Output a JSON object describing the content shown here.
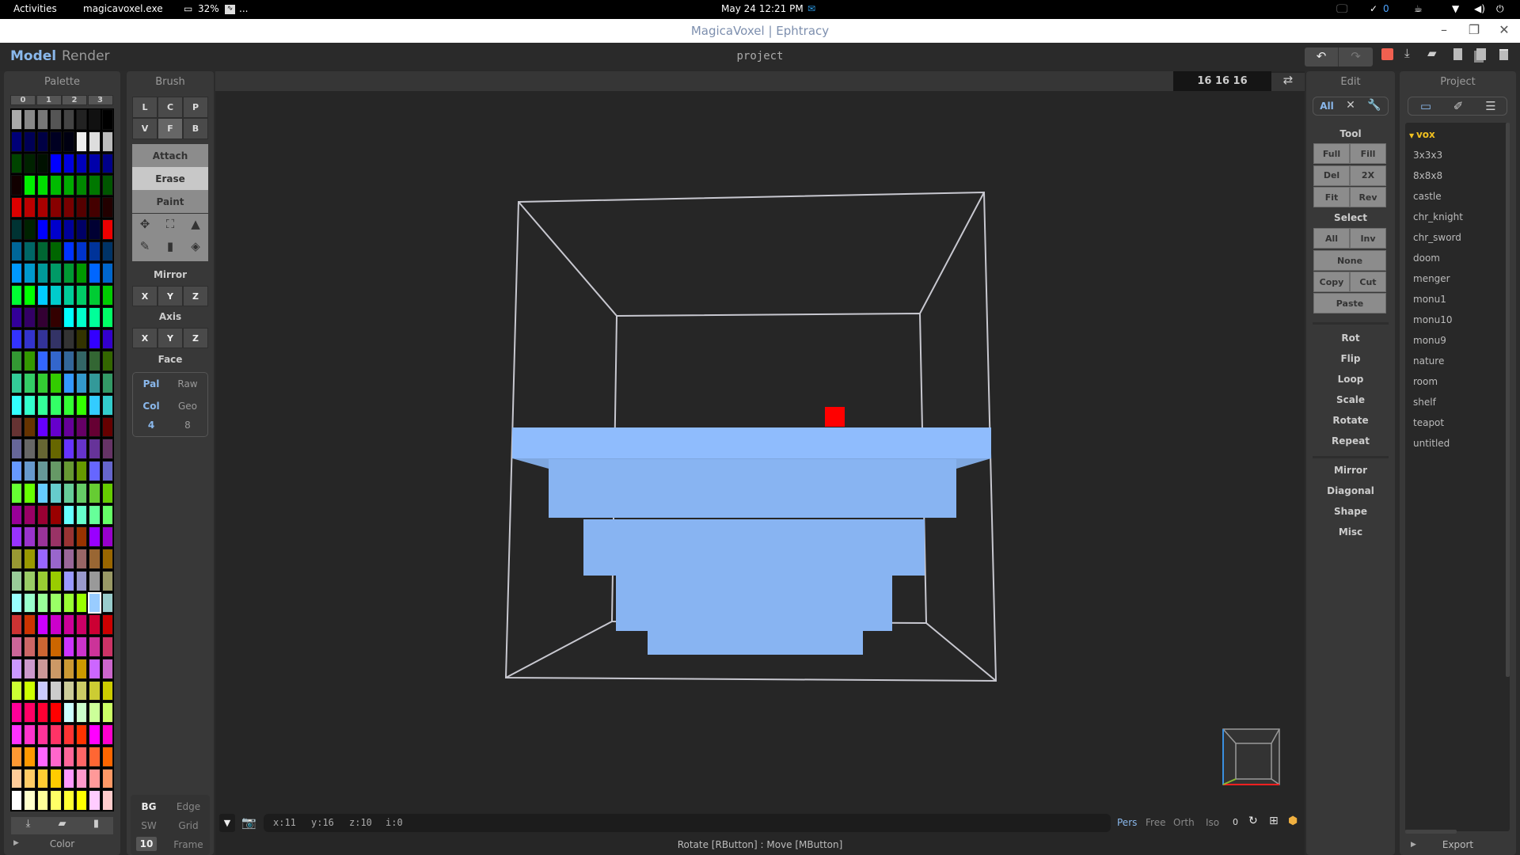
{
  "system_bar": {
    "activities": "Activities",
    "app_name": "magicavoxel.exe",
    "cpu": "32%",
    "ellipsis": "...",
    "datetime": "May 24  12:21 PM",
    "notifications": "0"
  },
  "window": {
    "title": "MagicaVoxel | Ephtracy"
  },
  "header": {
    "tabs": [
      {
        "label": "Model",
        "active": true
      },
      {
        "label": "Render",
        "active": false
      }
    ],
    "project_name": "project"
  },
  "palette": {
    "title": "Palette",
    "pages": [
      "0",
      "1",
      "2",
      "3"
    ],
    "footer_label": "Color",
    "selected_color": "#99ccff",
    "rows": [
      [
        "#aaaaaa",
        "#888888",
        "#777777",
        "#555555",
        "#444444",
        "#222222",
        "#111111",
        "#000000"
      ],
      [
        "#000077",
        "#000055",
        "#000044",
        "#000022",
        "#000011",
        "#eeeeee",
        "#dddddd",
        "#bbbbbb"
      ],
      [
        "#004400",
        "#002200",
        "#001100",
        "#0000ff",
        "#0000dd",
        "#0000bb",
        "#0000aa",
        "#000088"
      ],
      [
        "#110000",
        "#00ee00",
        "#00dd00",
        "#00bb00",
        "#00aa00",
        "#008800",
        "#007700",
        "#005500"
      ],
      [
        "#dd0000",
        "#bb0000",
        "#aa0000",
        "#880000",
        "#770000",
        "#550000",
        "#440000",
        "#220000"
      ],
      [
        "#003333",
        "#002200",
        "#0000ff",
        "#0000cc",
        "#000099",
        "#000066",
        "#000033",
        "#ee0000"
      ],
      [
        "#006699",
        "#006666",
        "#006633",
        "#006600",
        "#0033ff",
        "#0033cc",
        "#003399",
        "#003366"
      ],
      [
        "#0099ff",
        "#0099cc",
        "#009999",
        "#009966",
        "#009933",
        "#009900",
        "#0066ff",
        "#0066cc"
      ],
      [
        "#00ff33",
        "#00ff00",
        "#00ccff",
        "#00cccc",
        "#00cc99",
        "#00cc66",
        "#00cc33",
        "#00cc00"
      ],
      [
        "#330099",
        "#330066",
        "#330033",
        "#330000",
        "#00ffff",
        "#00ffcc",
        "#00ff99",
        "#00ff66"
      ],
      [
        "#3333ff",
        "#3333cc",
        "#333399",
        "#333366",
        "#333333",
        "#333300",
        "#3300ff",
        "#3300cc"
      ],
      [
        "#339933",
        "#339900",
        "#3366ff",
        "#3366cc",
        "#336699",
        "#336666",
        "#336633",
        "#336600"
      ],
      [
        "#33cc99",
        "#33cc66",
        "#33cc33",
        "#33cc00",
        "#3399ff",
        "#3399cc",
        "#339999",
        "#339966"
      ],
      [
        "#33ffff",
        "#33ffcc",
        "#33ff99",
        "#33ff66",
        "#33ff33",
        "#33ff00",
        "#33ccff",
        "#33cccc"
      ],
      [
        "#663333",
        "#663300",
        "#6600ff",
        "#6600cc",
        "#660099",
        "#660066",
        "#660033",
        "#660000"
      ],
      [
        "#666699",
        "#666666",
        "#666633",
        "#666600",
        "#6633ff",
        "#6633cc",
        "#663399",
        "#663366"
      ],
      [
        "#6699ff",
        "#6699cc",
        "#669999",
        "#669966",
        "#669933",
        "#669900",
        "#6666ff",
        "#6666cc"
      ],
      [
        "#66ff33",
        "#66ff00",
        "#66ccff",
        "#66cccc",
        "#66cc99",
        "#66cc66",
        "#66cc33",
        "#66cc00"
      ],
      [
        "#990099",
        "#990066",
        "#990033",
        "#990000",
        "#66ffff",
        "#66ffcc",
        "#66ff99",
        "#66ff66"
      ],
      [
        "#9933ff",
        "#9933cc",
        "#993399",
        "#993366",
        "#993333",
        "#993300",
        "#9900ff",
        "#9900cc"
      ],
      [
        "#999933",
        "#999900",
        "#9966ff",
        "#9966cc",
        "#996699",
        "#996666",
        "#996633",
        "#996600"
      ],
      [
        "#99cc99",
        "#99cc66",
        "#99cc33",
        "#99cc00",
        "#9999ff",
        "#9999cc",
        "#999999",
        "#999966"
      ],
      [
        "#99ffff",
        "#99ffcc",
        "#99ff99",
        "#99ff66",
        "#99ff33",
        "#99ff00",
        "#99ccff",
        "#99cccc"
      ],
      [
        "#cc3333",
        "#cc3300",
        "#cc00ff",
        "#cc00cc",
        "#cc0099",
        "#cc0066",
        "#cc0033",
        "#cc0000"
      ],
      [
        "#cc6699",
        "#cc6666",
        "#cc6633",
        "#cc6600",
        "#cc33ff",
        "#cc33cc",
        "#cc3399",
        "#cc3366"
      ],
      [
        "#cc99ff",
        "#cc99cc",
        "#cc9999",
        "#cc9966",
        "#cc9933",
        "#cc9900",
        "#cc66ff",
        "#cc66cc"
      ],
      [
        "#ccff33",
        "#ccff00",
        "#ccccff",
        "#cccccc",
        "#cccc99",
        "#cccc66",
        "#cccc33",
        "#cccc00"
      ],
      [
        "#ff0099",
        "#ff0066",
        "#ff0033",
        "#ff0000",
        "#ccffff",
        "#ccffcc",
        "#ccff99",
        "#ccff66"
      ],
      [
        "#ff33ff",
        "#ff33cc",
        "#ff3399",
        "#ff3366",
        "#ff3333",
        "#ff3300",
        "#ff00ff",
        "#ff00cc"
      ],
      [
        "#ff9933",
        "#ff9900",
        "#ff66ff",
        "#ff66cc",
        "#ff6699",
        "#ff6666",
        "#ff6633",
        "#ff6600"
      ],
      [
        "#ffcc99",
        "#ffcc66",
        "#ffcc33",
        "#ffcc00",
        "#ff99ff",
        "#ff99cc",
        "#ff9999",
        "#ff9966"
      ],
      [
        "#ffffff",
        "#ffffcc",
        "#ffff99",
        "#ffff66",
        "#ffff33",
        "#ffff00",
        "#ffccff",
        "#ffcccc"
      ]
    ]
  },
  "brush": {
    "title": "Brush",
    "types": [
      "L",
      "C",
      "P",
      "V",
      "F",
      "B"
    ],
    "active_type": "F",
    "modes": [
      "Attach",
      "Erase",
      "Paint"
    ],
    "active_mode": "Erase",
    "mirror_label": "Mirror",
    "mirror": [
      "X",
      "Y",
      "Z"
    ],
    "axis_label": "Axis",
    "axis": [
      "X",
      "Y",
      "Z"
    ],
    "face_label": "Face",
    "face": {
      "pal": "Pal",
      "raw": "Raw",
      "col": "Col",
      "geo": "Geo",
      "n4": "4",
      "n8": "8"
    },
    "display": {
      "bg": "BG",
      "edge": "Edge",
      "sw": "SW",
      "grid": "Grid",
      "frame_value": "10",
      "frame": "Frame"
    }
  },
  "viewport": {
    "dimensions": "16  16  16",
    "coords": {
      "x": "x:11",
      "y": "y:16",
      "z": "z:10",
      "i": "i:0"
    },
    "camera_modes": [
      "Pers",
      "Free",
      "Orth",
      "Iso"
    ],
    "active_camera": "Pers",
    "camera_value": "0",
    "status": "Rotate [RButton] : Move [MButton]",
    "model_color": "#8fbcfd",
    "cursor_color": "#ff0000"
  },
  "edit": {
    "title": "Edit",
    "filter_all": "All",
    "tool_label": "Tool",
    "tool": [
      "Full",
      "Fill",
      "Del",
      "2X",
      "Fit",
      "Rev"
    ],
    "select_label": "Select",
    "select": {
      "all": "All",
      "inv": "Inv",
      "none": "None",
      "copy": "Copy",
      "cut": "Cut",
      "paste": "Paste"
    },
    "transform": [
      "Rot",
      "Flip",
      "Loop",
      "Scale",
      "Rotate",
      "Repeat"
    ],
    "generate": [
      "Mirror",
      "Diagonal",
      "Shape",
      "Misc"
    ]
  },
  "project": {
    "title": "Project",
    "folder": "vox",
    "items": [
      "3x3x3",
      "8x8x8",
      "castle",
      "chr_knight",
      "chr_sword",
      "doom",
      "menger",
      "monu1",
      "monu10",
      "monu9",
      "nature",
      "room",
      "shelf",
      "teapot",
      "untitled"
    ],
    "export": "Export"
  }
}
